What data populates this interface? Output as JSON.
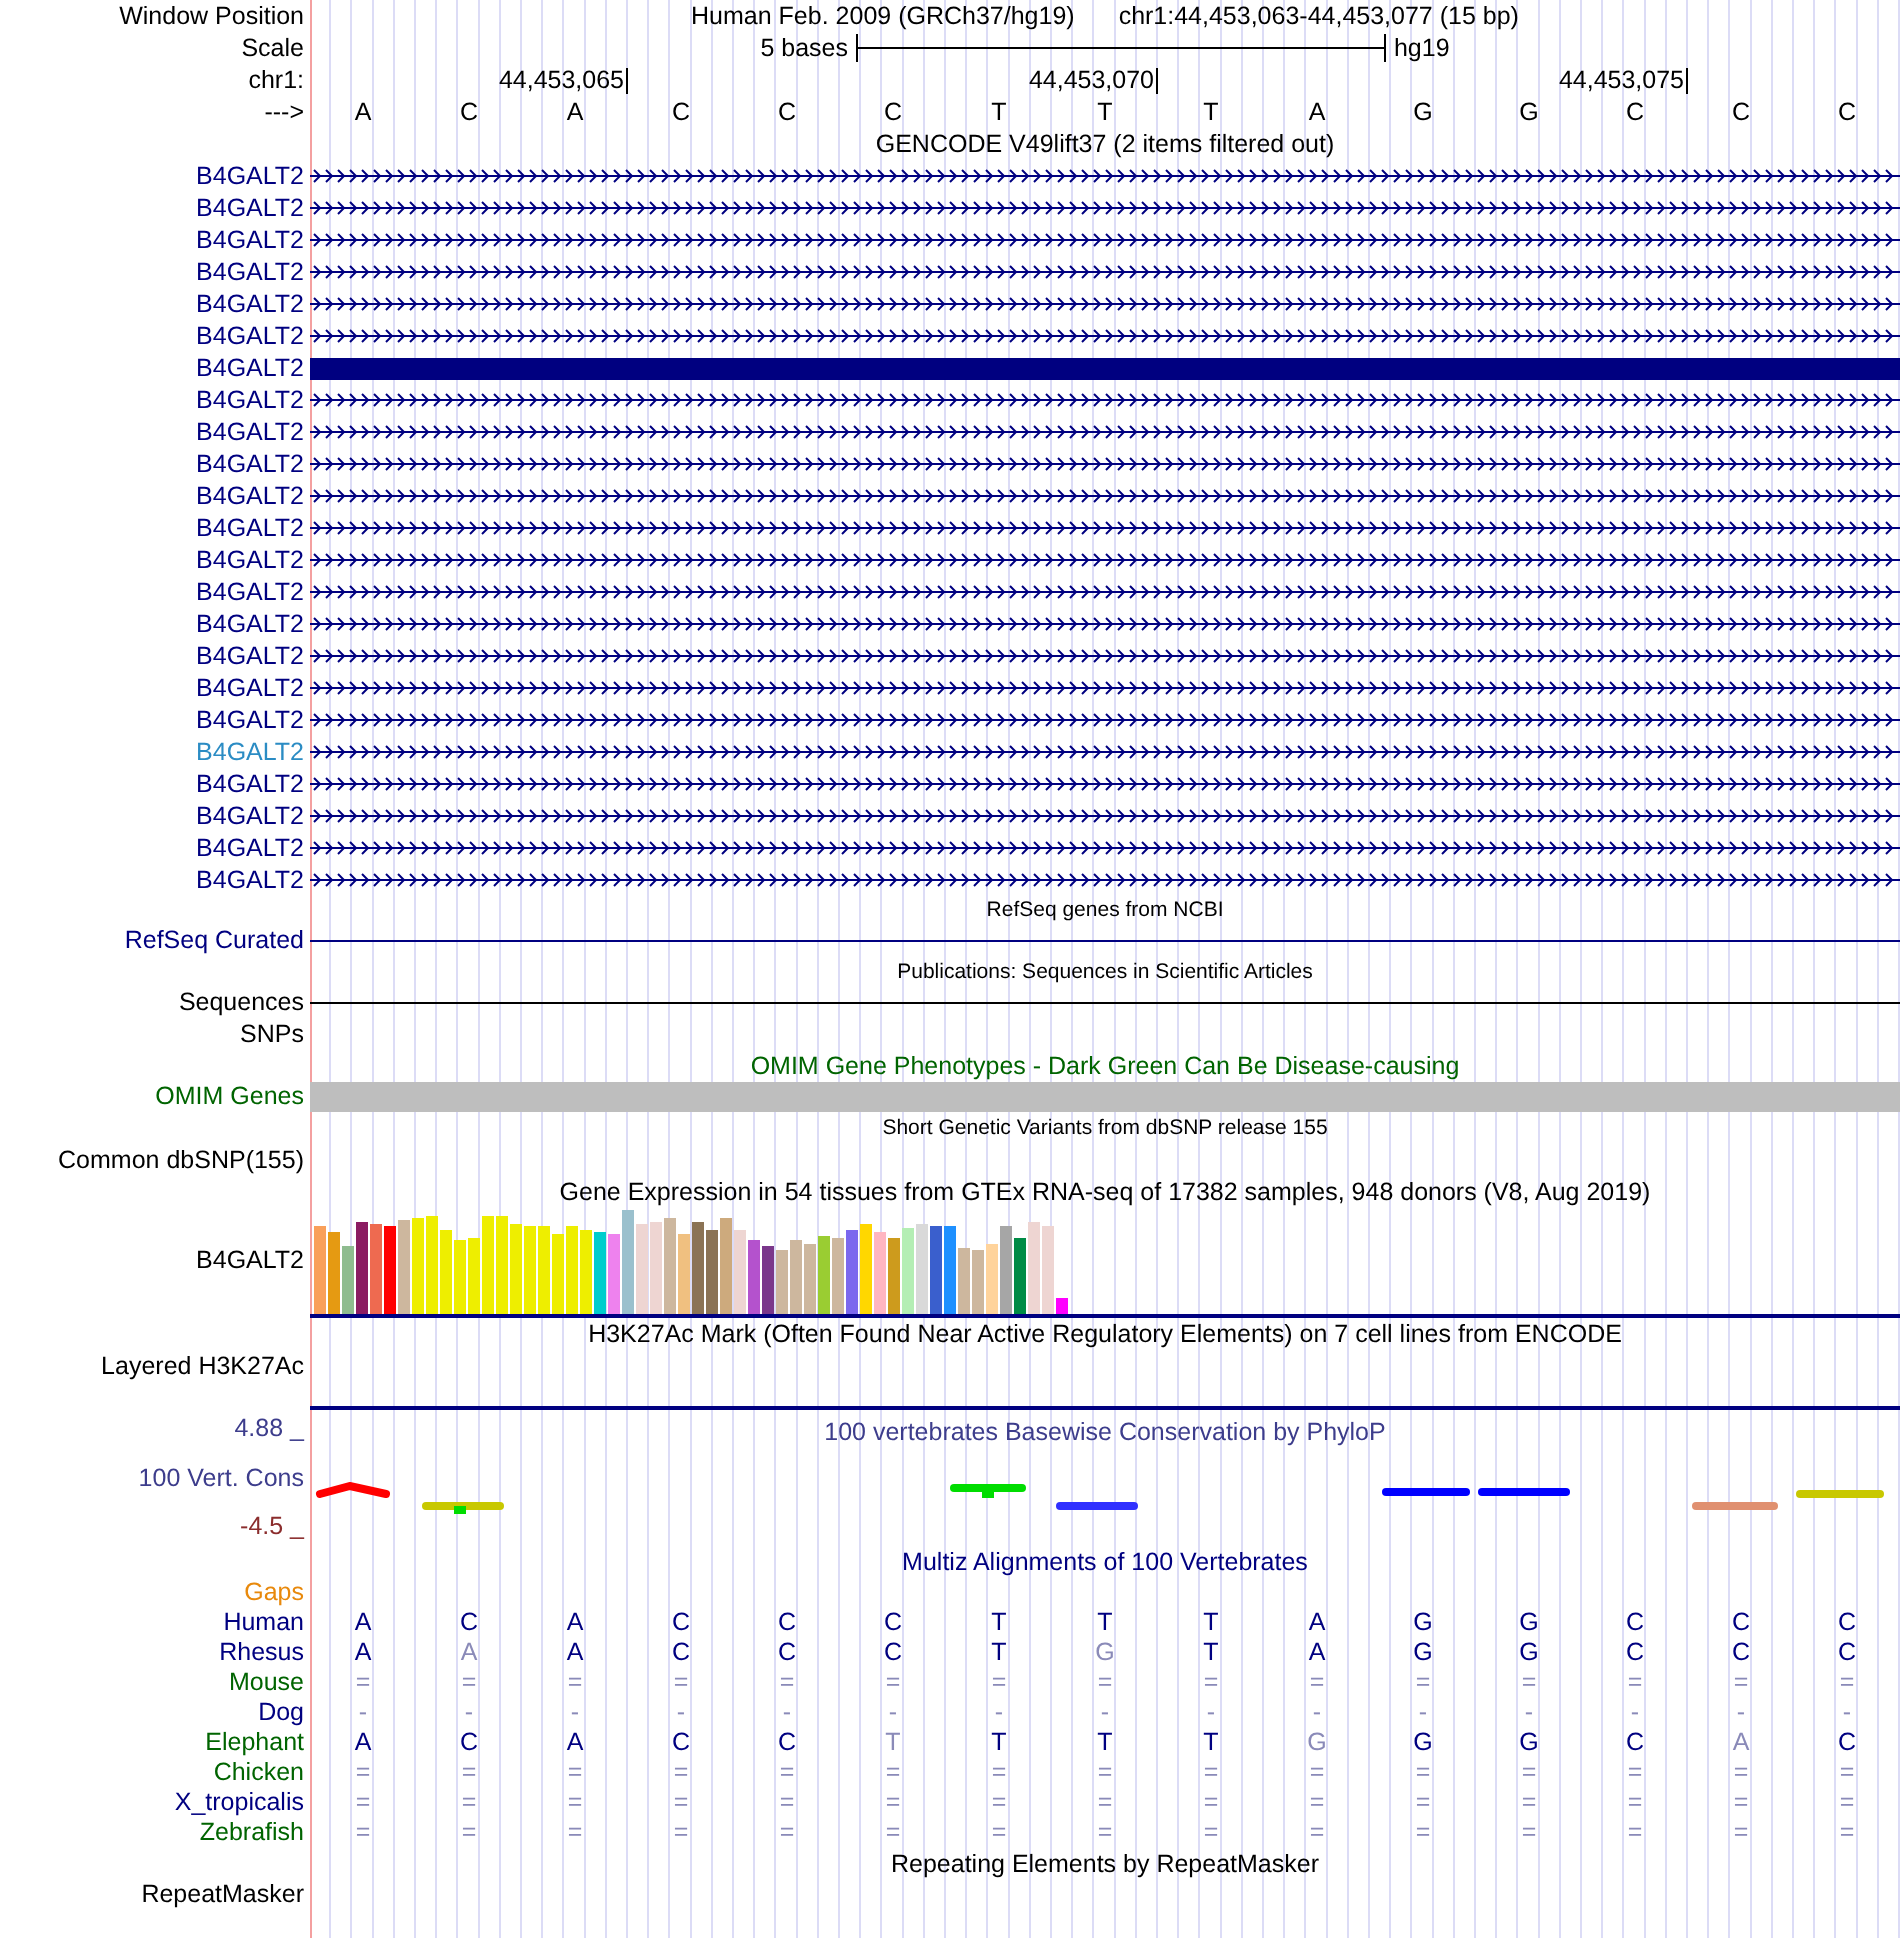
{
  "position": {
    "label": "Window Position",
    "assembly": "Human Feb. 2009 (GRCh37/hg19)",
    "range": "chr1:44,453,063-44,453,077 (15 bp)"
  },
  "scale": {
    "label": "Scale",
    "bar_label": "5 bases",
    "assembly": "hg19"
  },
  "ruler": {
    "label": "chr1:",
    "ticks": [
      "44,453,065",
      "44,453,070",
      "44,453,075"
    ]
  },
  "sequence": {
    "label": "--->",
    "bases": [
      "A",
      "C",
      "A",
      "C",
      "C",
      "C",
      "T",
      "T",
      "T",
      "A",
      "G",
      "G",
      "C",
      "C",
      "C"
    ]
  },
  "gencode": {
    "title": "GENCODE V49lift37 (2 items filtered out)",
    "transcripts": [
      {
        "name": "B4GALT2",
        "kind": "arrows",
        "visited": false
      },
      {
        "name": "B4GALT2",
        "kind": "arrows",
        "visited": false
      },
      {
        "name": "B4GALT2",
        "kind": "arrows",
        "visited": false
      },
      {
        "name": "B4GALT2",
        "kind": "arrows",
        "visited": false
      },
      {
        "name": "B4GALT2",
        "kind": "arrows",
        "visited": false
      },
      {
        "name": "B4GALT2",
        "kind": "arrows",
        "visited": false
      },
      {
        "name": "B4GALT2",
        "kind": "block",
        "visited": false
      },
      {
        "name": "B4GALT2",
        "kind": "arrows",
        "visited": false
      },
      {
        "name": "B4GALT2",
        "kind": "arrows",
        "visited": false
      },
      {
        "name": "B4GALT2",
        "kind": "arrows",
        "visited": false
      },
      {
        "name": "B4GALT2",
        "kind": "arrows",
        "visited": false
      },
      {
        "name": "B4GALT2",
        "kind": "arrows",
        "visited": false
      },
      {
        "name": "B4GALT2",
        "kind": "arrows",
        "visited": false
      },
      {
        "name": "B4GALT2",
        "kind": "arrows",
        "visited": false
      },
      {
        "name": "B4GALT2",
        "kind": "arrows",
        "visited": false
      },
      {
        "name": "B4GALT2",
        "kind": "arrows",
        "visited": false
      },
      {
        "name": "B4GALT2",
        "kind": "arrows",
        "visited": false
      },
      {
        "name": "B4GALT2",
        "kind": "arrows",
        "visited": false
      },
      {
        "name": "B4GALT2",
        "kind": "arrows",
        "visited": true
      },
      {
        "name": "B4GALT2",
        "kind": "arrows",
        "visited": false
      },
      {
        "name": "B4GALT2",
        "kind": "arrows",
        "visited": false
      },
      {
        "name": "B4GALT2",
        "kind": "arrows",
        "visited": false
      },
      {
        "name": "B4GALT2",
        "kind": "arrows",
        "visited": false
      }
    ]
  },
  "refseq": {
    "title": "RefSeq genes from NCBI",
    "label": "RefSeq Curated"
  },
  "publications": {
    "title": "Publications: Sequences in Scientific Articles",
    "label": "Sequences"
  },
  "snps": {
    "label": "SNPs"
  },
  "omim": {
    "title": "OMIM Gene Phenotypes - Dark Green Can Be Disease-causing",
    "label": "OMIM Genes"
  },
  "dbsnp": {
    "title": "Short Genetic Variants from dbSNP release 155",
    "label": "Common dbSNP(155)"
  },
  "gtex": {
    "title": "Gene Expression in 54 tissues from GTEx RNA-seq of 17382 samples, 948 donors (V8, Aug 2019)",
    "label": "B4GALT2"
  },
  "h3k27ac": {
    "title": "H3K27Ac Mark (Often Found Near Active Regulatory Elements) on 7 cell lines from ENCODE",
    "label": "Layered H3K27Ac"
  },
  "phylop": {
    "title": "100 vertebrates Basewise Conservation by PhyloP",
    "label": "100 Vert. Cons",
    "max_label": "4.88 _",
    "min_label": "-4.5 _"
  },
  "multiz": {
    "title": "Multiz Alignments of 100 Vertebrates",
    "gaps_label": "Gaps",
    "species": [
      {
        "name": "Human",
        "color": "#000080",
        "bases": [
          {
            "b": "A",
            "faded": false
          },
          {
            "b": "C",
            "faded": false
          },
          {
            "b": "A",
            "faded": false
          },
          {
            "b": "C",
            "faded": false
          },
          {
            "b": "C",
            "faded": false
          },
          {
            "b": "C",
            "faded": false
          },
          {
            "b": "T",
            "faded": false
          },
          {
            "b": "T",
            "faded": false
          },
          {
            "b": "T",
            "faded": false
          },
          {
            "b": "A",
            "faded": false
          },
          {
            "b": "G",
            "faded": false
          },
          {
            "b": "G",
            "faded": false
          },
          {
            "b": "C",
            "faded": false
          },
          {
            "b": "C",
            "faded": false
          },
          {
            "b": "C",
            "faded": false
          }
        ]
      },
      {
        "name": "Rhesus",
        "color": "#000080",
        "bases": [
          {
            "b": "A",
            "faded": false
          },
          {
            "b": "A",
            "faded": true
          },
          {
            "b": "A",
            "faded": false
          },
          {
            "b": "C",
            "faded": false
          },
          {
            "b": "C",
            "faded": false
          },
          {
            "b": "C",
            "faded": false
          },
          {
            "b": "T",
            "faded": false
          },
          {
            "b": "G",
            "faded": true
          },
          {
            "b": "T",
            "faded": false
          },
          {
            "b": "A",
            "faded": false
          },
          {
            "b": "G",
            "faded": false
          },
          {
            "b": "G",
            "faded": false
          },
          {
            "b": "C",
            "faded": false
          },
          {
            "b": "C",
            "faded": false
          },
          {
            "b": "C",
            "faded": false
          }
        ]
      },
      {
        "name": "Mouse",
        "color": "#006400",
        "bases": [
          {
            "b": "=",
            "faded": true
          },
          {
            "b": "=",
            "faded": true
          },
          {
            "b": "=",
            "faded": true
          },
          {
            "b": "=",
            "faded": true
          },
          {
            "b": "=",
            "faded": true
          },
          {
            "b": "=",
            "faded": true
          },
          {
            "b": "=",
            "faded": true
          },
          {
            "b": "=",
            "faded": true
          },
          {
            "b": "=",
            "faded": true
          },
          {
            "b": "=",
            "faded": true
          },
          {
            "b": "=",
            "faded": true
          },
          {
            "b": "=",
            "faded": true
          },
          {
            "b": "=",
            "faded": true
          },
          {
            "b": "=",
            "faded": true
          },
          {
            "b": "=",
            "faded": true
          }
        ]
      },
      {
        "name": "Dog",
        "color": "#000080",
        "bases": [
          {
            "b": "-",
            "faded": true
          },
          {
            "b": "-",
            "faded": true
          },
          {
            "b": "-",
            "faded": true
          },
          {
            "b": "-",
            "faded": true
          },
          {
            "b": "-",
            "faded": true
          },
          {
            "b": "-",
            "faded": true
          },
          {
            "b": "-",
            "faded": true
          },
          {
            "b": "-",
            "faded": true
          },
          {
            "b": "-",
            "faded": true
          },
          {
            "b": "-",
            "faded": true
          },
          {
            "b": "-",
            "faded": true
          },
          {
            "b": "-",
            "faded": true
          },
          {
            "b": "-",
            "faded": true
          },
          {
            "b": "-",
            "faded": true
          },
          {
            "b": "-",
            "faded": true
          }
        ]
      },
      {
        "name": "Elephant",
        "color": "#006400",
        "bases": [
          {
            "b": "A",
            "faded": false
          },
          {
            "b": "C",
            "faded": false
          },
          {
            "b": "A",
            "faded": false
          },
          {
            "b": "C",
            "faded": false
          },
          {
            "b": "C",
            "faded": false
          },
          {
            "b": "T",
            "faded": true
          },
          {
            "b": "T",
            "faded": false
          },
          {
            "b": "T",
            "faded": false
          },
          {
            "b": "T",
            "faded": false
          },
          {
            "b": "G",
            "faded": true
          },
          {
            "b": "G",
            "faded": false
          },
          {
            "b": "G",
            "faded": false
          },
          {
            "b": "C",
            "faded": false
          },
          {
            "b": "A",
            "faded": true
          },
          {
            "b": "C",
            "faded": false
          }
        ]
      },
      {
        "name": "Chicken",
        "color": "#006400",
        "bases": [
          {
            "b": "=",
            "faded": true
          },
          {
            "b": "=",
            "faded": true
          },
          {
            "b": "=",
            "faded": true
          },
          {
            "b": "=",
            "faded": true
          },
          {
            "b": "=",
            "faded": true
          },
          {
            "b": "=",
            "faded": true
          },
          {
            "b": "=",
            "faded": true
          },
          {
            "b": "=",
            "faded": true
          },
          {
            "b": "=",
            "faded": true
          },
          {
            "b": "=",
            "faded": true
          },
          {
            "b": "=",
            "faded": true
          },
          {
            "b": "=",
            "faded": true
          },
          {
            "b": "=",
            "faded": true
          },
          {
            "b": "=",
            "faded": true
          },
          {
            "b": "=",
            "faded": true
          }
        ]
      },
      {
        "name": "X_tropicalis",
        "color": "#000080",
        "bases": [
          {
            "b": "=",
            "faded": true
          },
          {
            "b": "=",
            "faded": true
          },
          {
            "b": "=",
            "faded": true
          },
          {
            "b": "=",
            "faded": true
          },
          {
            "b": "=",
            "faded": true
          },
          {
            "b": "=",
            "faded": true
          },
          {
            "b": "=",
            "faded": true
          },
          {
            "b": "=",
            "faded": true
          },
          {
            "b": "=",
            "faded": true
          },
          {
            "b": "=",
            "faded": true
          },
          {
            "b": "=",
            "faded": true
          },
          {
            "b": "=",
            "faded": true
          },
          {
            "b": "=",
            "faded": true
          },
          {
            "b": "=",
            "faded": true
          },
          {
            "b": "=",
            "faded": true
          }
        ]
      },
      {
        "name": "Zebrafish",
        "color": "#006400",
        "bases": [
          {
            "b": "=",
            "faded": true
          },
          {
            "b": "=",
            "faded": true
          },
          {
            "b": "=",
            "faded": true
          },
          {
            "b": "=",
            "faded": true
          },
          {
            "b": "=",
            "faded": true
          },
          {
            "b": "=",
            "faded": true
          },
          {
            "b": "=",
            "faded": true
          },
          {
            "b": "=",
            "faded": true
          },
          {
            "b": "=",
            "faded": true
          },
          {
            "b": "=",
            "faded": true
          },
          {
            "b": "=",
            "faded": true
          },
          {
            "b": "=",
            "faded": true
          },
          {
            "b": "=",
            "faded": true
          },
          {
            "b": "=",
            "faded": true
          },
          {
            "b": "=",
            "faded": true
          }
        ]
      }
    ]
  },
  "repeatmasker": {
    "title": "Repeating Elements by RepeatMasker",
    "label": "RepeatMasker"
  }
}
